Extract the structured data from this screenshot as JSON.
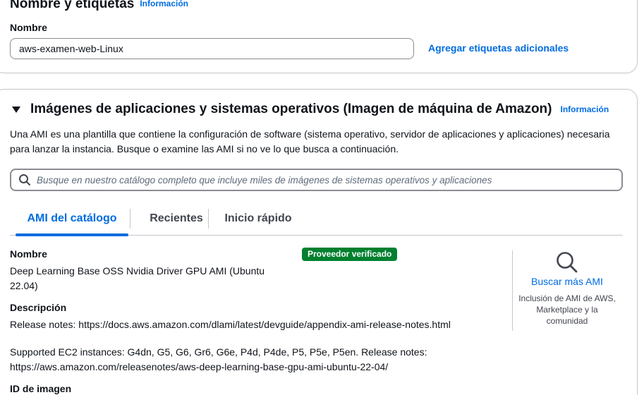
{
  "tags_section": {
    "title": "Nombre y etiquetas",
    "info": "Información",
    "name_label": "Nombre",
    "name_value": "aws-examen-web-Linux",
    "add_tags": "Agregar etiquetas adicionales"
  },
  "ami_section": {
    "title": "Imágenes de aplicaciones y sistemas operativos (Imagen de máquina de Amazon)",
    "info": "Información",
    "description": "Una AMI es una plantilla que contiene la configuración de software (sistema operativo, servidor de aplicaciones y aplicaciones) necesaria para lanzar la instancia. Busque o examine las AMI si no ve lo que busca a continuación.",
    "search_placeholder": "Busque en nuestro catálogo completo que incluye miles de imágenes de sistemas operativos y aplicaciones",
    "tabs": [
      {
        "label": "AMI del catálogo",
        "active": true
      },
      {
        "label": "Recientes",
        "active": false
      },
      {
        "label": "Inicio rápido",
        "active": false
      }
    ],
    "selected_ami": {
      "name_label": "Nombre",
      "name_value": "Deep Learning Base OSS Nvidia Driver GPU AMI (Ubuntu 22.04)",
      "badge": "Proveedor verificado",
      "description_label": "Descripción",
      "description_line1": "Release notes: https://docs.aws.amazon.com/dlami/latest/devguide/appendix-ami-release-notes.html",
      "description_line2": "Supported EC2 instances: G4dn, G5, G6, Gr6, G6e, P4d, P4de, P5, P5e, P5en. Release notes: https://aws.amazon.com/releasenotes/aws-deep-learning-base-gpu-ami-ubuntu-22-04/",
      "image_id_label": "ID de imagen"
    },
    "browse": {
      "icon": "search-icon",
      "link": "Buscar más AMI",
      "subtext": "Inclusión de AMI de AWS, Marketplace y la comunidad"
    }
  },
  "colors": {
    "link": "#006ce0",
    "badge_bg": "#00802f",
    "border": "#c6c6cd",
    "text": "#0f141a"
  }
}
